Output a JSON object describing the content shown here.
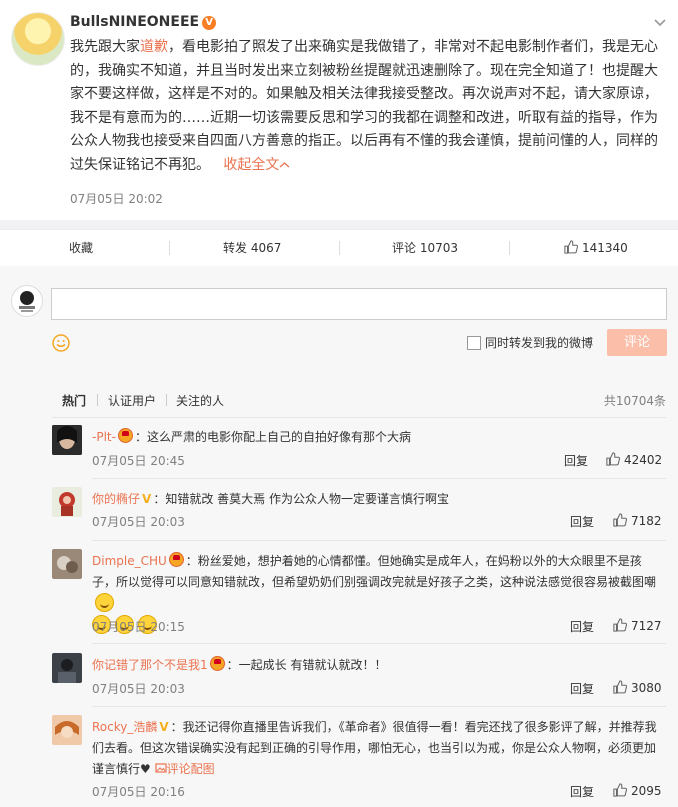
{
  "post": {
    "username": "BullsNINEONEEE",
    "text_before_tag": "我先跟大家",
    "tag": "道歉",
    "text_after_tag": "，看电影拍了照发了出来确实是我做错了，非常对不起电影制作者们，我是无心的，我确实不知道，并且当时发出来立刻被粉丝提醒就迅速删除了。现在完全知道了！也提醒大家不要这样做，这样是不对的。如果触及相关法律我接受整改。再次说声对不起，请大家原谅，我不是有意而为的……近期一切该需要反思和学习的我都在调整和改进，听取有益的指导，作为公众人物我也接受来自四面八方善意的指正。以后再有不懂的我会谨慎，提前问懂的人，同样的过失保证铭记不再犯。",
    "collapse_link": "收起全文",
    "time": "07月05日 20:02"
  },
  "actions": {
    "favorite": "收藏",
    "repost": "转发 4067",
    "comment": "评论 10703",
    "like": "141340"
  },
  "composer": {
    "placeholder": "",
    "also_repost_label": "同时转发到我的微博",
    "submit_label": "评论"
  },
  "comment_tabs": {
    "hot": "热门",
    "verified": "认证用户",
    "following": "关注的人",
    "total": "共10704条"
  },
  "comments": [
    {
      "user": "-Plt-",
      "badge": "crown",
      "text": "：这么严肃的电影你配上自己的自拍好像有那个大病",
      "time": "07月05日 20:45",
      "reply": "回复",
      "likes": "42402"
    },
    {
      "user": "你的椭仔",
      "badge": "v",
      "text": "：知错就改 善莫大焉 作为公众人物一定要谨言慎行啊宝",
      "time": "07月05日 20:03",
      "reply": "回复",
      "likes": "7182"
    },
    {
      "user": "Dimple_CHU",
      "badge": "crown",
      "text": "：粉丝爱她，想护着她的心情都懂。但她确实是成年人，在妈粉以外的大众眼里不是孩子，所以觉得可以同意知错就改，但希望奶奶们别强调改完就是好孩子之类，这种说法感觉很容易被截图嘲",
      "time": "07月05日 20:15",
      "reply": "回复",
      "likes": "7127"
    },
    {
      "user": "你记错了那个不是我1",
      "badge": "crown",
      "text": "：一起成长 有错就认就改！！",
      "time": "07月05日 20:03",
      "reply": "回复",
      "likes": "3080"
    },
    {
      "user": "Rocky_浩麟",
      "badge": "v",
      "text": "：我还记得你直播里告诉我们，《革命者》很值得一看！看完还找了很多影评了解，并推荐我们去看。但这次错误确实没有起到正确的引导作用，哪怕无心，也当引以为戒，你是公众人物啊，必须更加谨言慎行",
      "link": "评论配图",
      "time": "07月05日 20:16",
      "reply": "回复",
      "likes": "2095"
    }
  ],
  "colors": {
    "accent": "#eb7350",
    "muted": "#808080",
    "submit_bg": "#fbbea9"
  }
}
